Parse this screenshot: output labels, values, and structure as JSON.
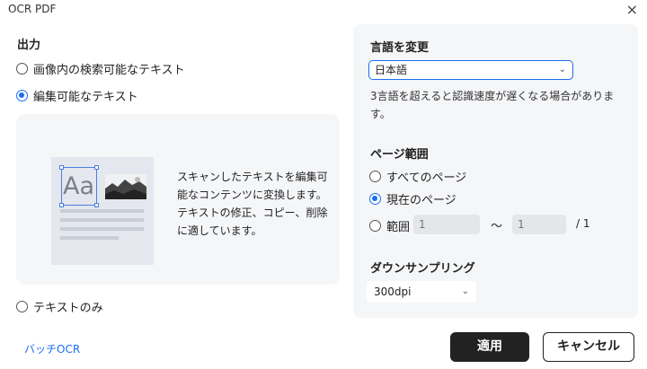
{
  "window": {
    "title": "OCR PDF",
    "close_glyph": "×"
  },
  "output": {
    "heading": "出力",
    "options": [
      {
        "label": "画像内の検索可能なテキスト",
        "selected": false
      },
      {
        "label": "編集可能なテキスト",
        "selected": true
      },
      {
        "label": "テキストのみ",
        "selected": false
      }
    ],
    "preview": {
      "sample_text": "Aa",
      "description": [
        "スキャンしたテキストを編集可",
        "能なコンテンツに変換します。",
        "テキストの修正、コピー、削除",
        "に適しています。"
      ]
    }
  },
  "language": {
    "heading": "言語を変更",
    "selected": "日本語",
    "note": [
      "3言語を超えると認識速度が遅くなる場合がありま",
      "す。"
    ]
  },
  "page_range": {
    "heading": "ページ範囲",
    "options": [
      {
        "label": "すべてのページ",
        "selected": false
      },
      {
        "label": "現在のページ",
        "selected": true
      },
      {
        "label": "範囲",
        "selected": false
      }
    ],
    "from_placeholder": "1",
    "to_placeholder": "1",
    "separator": "～",
    "total": "/ 1"
  },
  "downsampling": {
    "heading": "ダウンサンプリング",
    "selected": "300dpi"
  },
  "footer": {
    "batch_link": "バッチOCR",
    "apply": "適用",
    "cancel": "キャンセル"
  },
  "colors": {
    "accent": "#1a6ef5",
    "primary_button": "#222222",
    "panel": "#f5f6f8"
  }
}
